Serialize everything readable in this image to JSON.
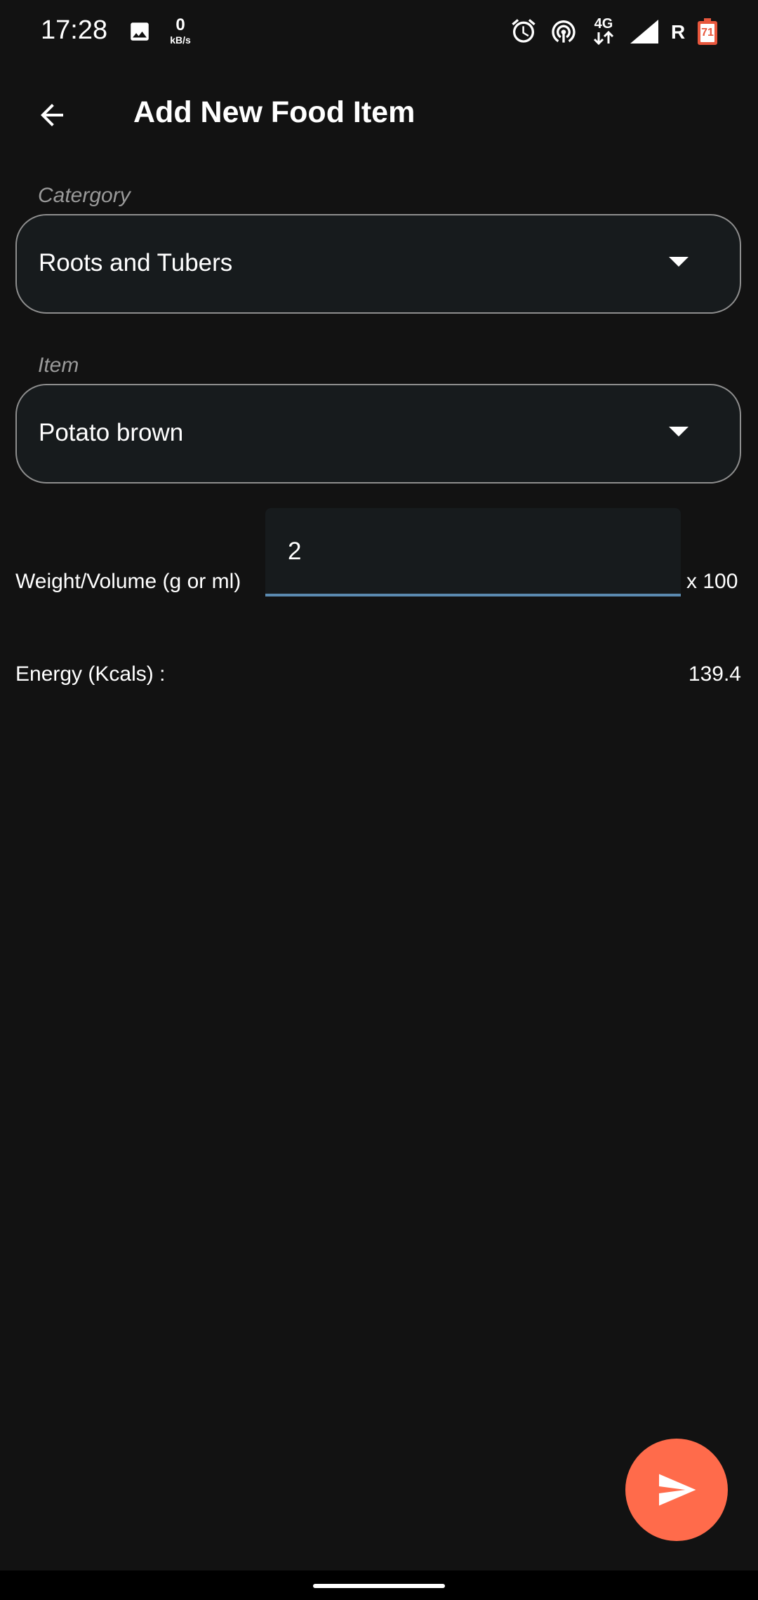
{
  "status_bar": {
    "time": "17:28",
    "net_speed_value": "0",
    "net_speed_unit": "kB/s",
    "network_type": "4G",
    "roaming": "R",
    "battery_level": "71",
    "icons": [
      "image-icon",
      "alarm-icon",
      "hotspot-icon",
      "data-arrows-icon",
      "signal-icon",
      "battery-icon"
    ]
  },
  "header": {
    "title": "Add New Food Item"
  },
  "category": {
    "label": "Catergory",
    "value": "Roots and Tubers"
  },
  "item": {
    "label": "Item",
    "value": "Potato brown"
  },
  "weight": {
    "label": "Weight/Volume (g or ml)",
    "value": "2",
    "multiplier": "x 100"
  },
  "energy": {
    "label": "Energy (Kcals) :",
    "value": "139.4"
  },
  "colors": {
    "background": "#121212",
    "field_background": "#171b1d",
    "accent": "#ff6b4b",
    "input_underline": "#5b8ab0"
  }
}
